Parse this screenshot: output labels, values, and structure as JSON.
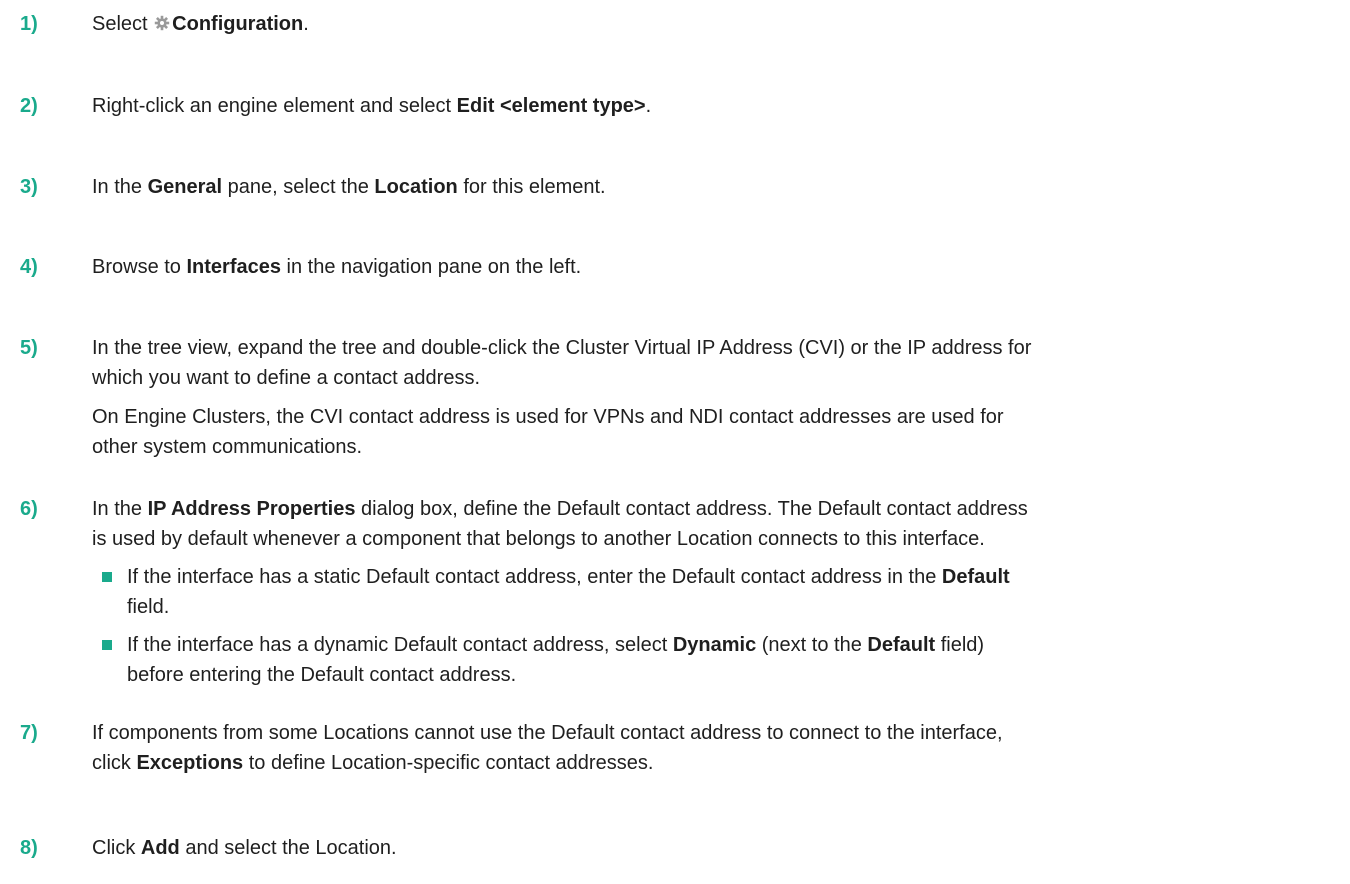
{
  "steps": [
    {
      "num": "1)",
      "parts": [
        "Select ",
        "Configuration",
        "."
      ]
    },
    {
      "num": "2)",
      "parts": [
        "Right-click an engine element and select ",
        "Edit <element type>",
        "."
      ]
    },
    {
      "num": "3)",
      "parts": [
        "In the ",
        "General",
        " pane, select the ",
        "Location",
        " for this element."
      ]
    },
    {
      "num": "4)",
      "parts": [
        "Browse to ",
        "Interfaces",
        " in the navigation pane on the left."
      ]
    },
    {
      "num": "5)",
      "line1": "In the tree view, expand the tree and double-click the Cluster Virtual IP Address (CVI) or the IP address for",
      "line2": "which you want to define a contact address.",
      "note1": "On Engine Clusters, the CVI contact address is used for VPNs and NDI contact addresses are used for",
      "note2": "other system communications."
    },
    {
      "num": "6)",
      "parts": [
        "In the ",
        "IP Address Properties",
        " dialog box, define the Default contact address. The Default contact address"
      ],
      "line2": "is used by default whenever a component that belongs to another Location connects to this interface.",
      "bullets": [
        {
          "parts": [
            "If the interface has a static Default contact address, enter the Default contact address in the ",
            "Default"
          ],
          "line2": "field."
        },
        {
          "parts": [
            "If the interface has a dynamic Default contact address, select ",
            "Dynamic",
            " (next to the ",
            "Default",
            " field)"
          ],
          "line2": "before entering the Default contact address."
        }
      ]
    },
    {
      "num": "7)",
      "line1": "If components from some Locations cannot use the Default contact address to connect to the interface,",
      "parts2": [
        "click ",
        "Exceptions",
        " to define Location-specific contact addresses."
      ]
    },
    {
      "num": "8)",
      "parts": [
        "Click ",
        "Add",
        " and select the Location."
      ]
    }
  ],
  "icons": {
    "configuration": "gear-icon"
  },
  "colors": {
    "accent": "#1aaa8c",
    "text": "#1f1f1f"
  }
}
